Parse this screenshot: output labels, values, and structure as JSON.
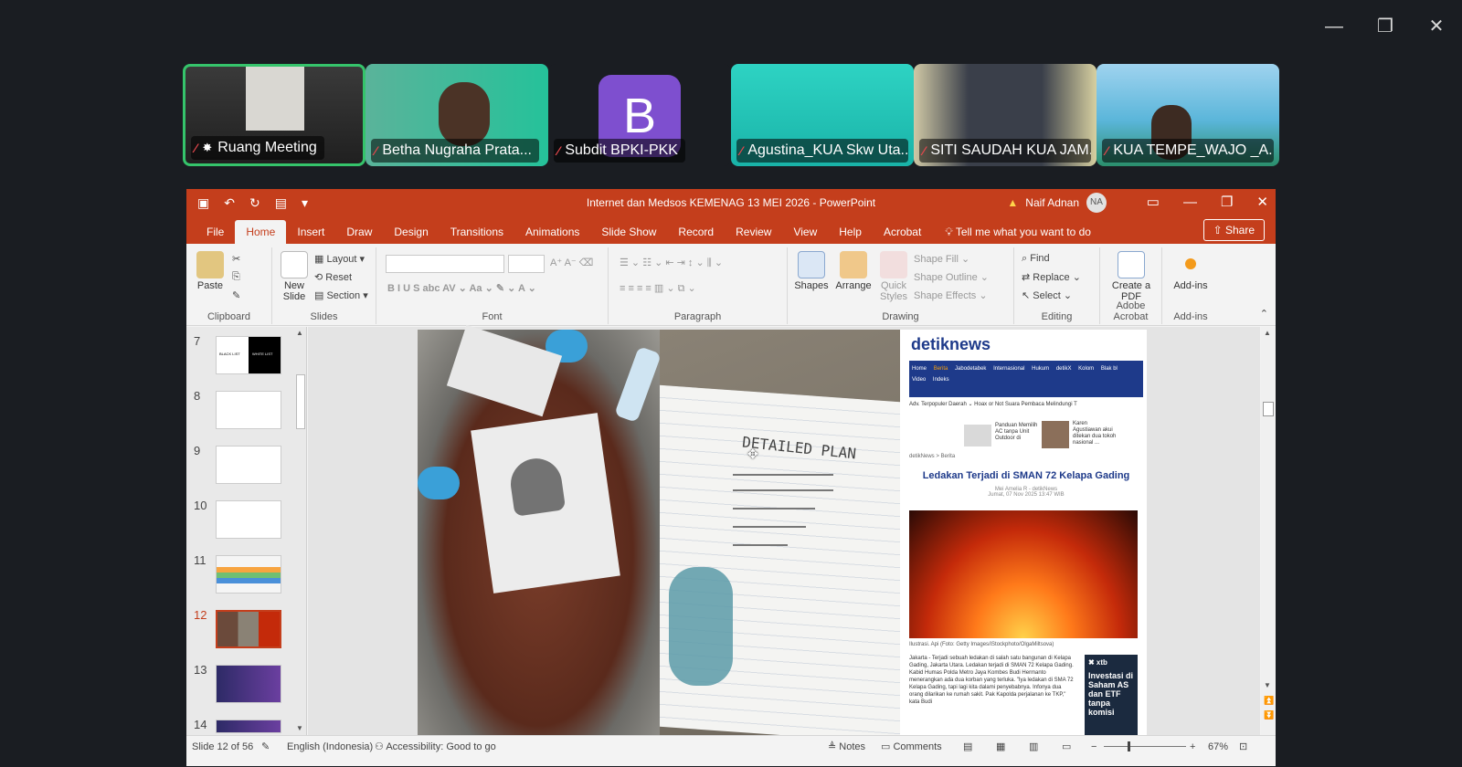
{
  "window_controls": {
    "minimize": "—",
    "restore": "❐",
    "close": "✕"
  },
  "participants": [
    {
      "name": "Ruang Meeting",
      "muted": true,
      "pinned": true,
      "active": true
    },
    {
      "name": "Betha Nugraha Prata...",
      "muted": true
    },
    {
      "name": "Subdit BPKI-PKK",
      "muted": true,
      "avatar_letter": "B",
      "avatar_color": "#7e4fcf"
    },
    {
      "name": "Agustina_KUA Skw Uta...",
      "muted": true
    },
    {
      "name": "SITI SAUDAH KUA JAM...",
      "muted": true
    },
    {
      "name": "KUA TEMPE_WAJO _A...",
      "muted": true
    }
  ],
  "ppt": {
    "title": "Internet dan Medsos KEMENAG 13 MEI 2026  -  PowerPoint",
    "user_name": "Naif Adnan",
    "user_initials": "NA",
    "menu_tabs": [
      "File",
      "Home",
      "Insert",
      "Draw",
      "Design",
      "Transitions",
      "Animations",
      "Slide Show",
      "Record",
      "Review",
      "View",
      "Help",
      "Acrobat"
    ],
    "tell_me": "Tell me what you want to do",
    "share_label": "Share",
    "ribbon": {
      "clipboard": {
        "label": "Clipboard",
        "paste": "Paste"
      },
      "slides": {
        "label": "Slides",
        "new_slide": "New Slide",
        "layout": "Layout",
        "reset": "Reset",
        "section": "Section"
      },
      "font": {
        "label": "Font"
      },
      "paragraph": {
        "label": "Paragraph"
      },
      "drawing": {
        "label": "Drawing",
        "shapes": "Shapes",
        "arrange": "Arrange",
        "quick_styles": "Quick Styles",
        "shape_fill": "Shape Fill",
        "shape_outline": "Shape Outline",
        "shape_effects": "Shape Effects"
      },
      "editing": {
        "label": "Editing",
        "find": "Find",
        "replace": "Replace",
        "select": "Select"
      },
      "adobe": {
        "label": "Adobe Acrobat",
        "create_pdf": "Create a PDF"
      },
      "addins": {
        "label": "Add-ins",
        "addins": "Add-ins"
      }
    },
    "thumbnails": [
      {
        "num": "7",
        "text_left": "BLACK LIST",
        "text_right": "WHITE LIST"
      },
      {
        "num": "8"
      },
      {
        "num": "9"
      },
      {
        "num": "10"
      },
      {
        "num": "11"
      },
      {
        "num": "12",
        "selected": true
      },
      {
        "num": "13"
      },
      {
        "num": "14"
      }
    ],
    "slide": {
      "plan_title": "DETAILED PLAN",
      "news": {
        "logo": "detiknews",
        "nav_items": [
          "Home",
          "Berita",
          "Jabodetabek",
          "Internasional",
          "Hukum",
          "detikX",
          "Kolom",
          "Blak bl",
          "Video",
          "Indeks"
        ],
        "row2": "Adv. Terpopuler  Daerah ⌄  Hoax or Not  Suara Pembaca  Melindungi T",
        "ad1": "Panduan Memilih AC tanpa Unit Outdoor di",
        "ad2": "Karen Agustiawan akui ditekan dua tokoh nasional ...",
        "crumb": "detikNews  >  Berita",
        "headline": "Ledakan Terjadi di SMAN 72 Kelapa Gading",
        "byline": "Mei Amelia R - detikNews",
        "date": "Jumat, 07 Nov 2025 13:47 WIB",
        "caption": "Ilustrasi. Api (Foto: Getty Images/iStockphoto/OlgaMiltsova)",
        "body": "Jakarta - Terjadi sebuah ledakan di salah satu bangunan di Kelapa Gading, Jakarta Utara. Ledakan terjadi di SMAN 72 Kelapa Gading. Kabid Humas Polda Metro Jaya Kombes Budi Hermanto menerangkan ada dua korban yang terluka. \"Iya ledakan di SMA 72 Kelapa Gading, tapi lagi kita dalami penyebabnya. Infonya dua orang dilarikan ke rumah sakit. Pak Kapolda perjalanan ke TKP,\" kata Budi",
        "xtb_brand": "✖ xtb",
        "xtb_text": "Investasi di Saham AS dan ETF tanpa komisi"
      }
    },
    "status": {
      "slide_info": "Slide 12 of 56",
      "language": "English (Indonesia)",
      "accessibility": "Accessibility: Good to go",
      "notes": "Notes",
      "comments": "Comments",
      "zoom": "67%"
    }
  }
}
